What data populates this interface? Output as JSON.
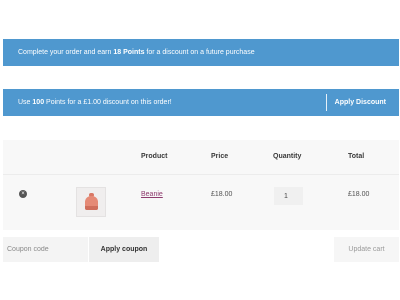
{
  "notices": {
    "earn": {
      "prefix": "Complete your order and earn ",
      "points": "18 Points",
      "suffix": " for a discount on a future purchase"
    },
    "redeem": {
      "prefix": "Use ",
      "points": "100",
      "suffix": " Points for a £1.00 discount on this order!",
      "apply_label": "Apply Discount"
    }
  },
  "cart": {
    "headers": {
      "product": "Product",
      "price": "Price",
      "quantity": "Quantity",
      "total": "Total"
    },
    "items": [
      {
        "remove_symbol": "×",
        "thumbnail_icon": "beanie-thumbnail",
        "name": "Beanie",
        "price": "£18.00",
        "quantity": "1",
        "total": "£18.00"
      }
    ]
  },
  "actions": {
    "coupon_placeholder": "Coupon code",
    "apply_coupon_label": "Apply coupon",
    "update_cart_label": "Update cart"
  },
  "colors": {
    "notice_blue": "#4f98cf",
    "product_link": "#8f3b6e"
  }
}
